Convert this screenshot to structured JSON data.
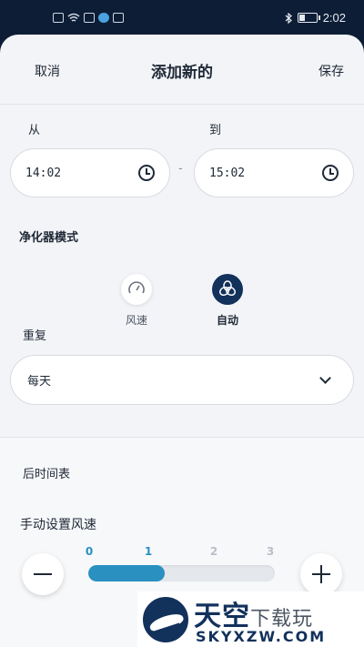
{
  "status_bar": {
    "time": "2:02"
  },
  "header": {
    "cancel_label": "取消",
    "title": "添加新的",
    "save_label": "保存"
  },
  "time_range": {
    "from_label": "从",
    "to_label": "到",
    "from_value": "14:02",
    "to_value": "15:02",
    "separator": "-"
  },
  "purifier_mode": {
    "label": "净化器模式",
    "options": [
      {
        "label": "风速",
        "icon": "gauge-icon",
        "selected": false
      },
      {
        "label": "自动",
        "icon": "swirl-icon",
        "selected": true
      }
    ]
  },
  "repeat": {
    "label": "重复",
    "value": "每天"
  },
  "schedule": {
    "label": "后时间表"
  },
  "fan_speed": {
    "label": "手动设置风速",
    "steps": [
      "0",
      "1",
      "2",
      "3"
    ],
    "current": 1,
    "max": 3,
    "accent": "#2a90c0"
  },
  "watermark": {
    "brand_cn": "天空",
    "brand_cn_small": "下载玩",
    "brand_en": "SKYXZW.COM"
  },
  "colors": {
    "navy": "#12315b",
    "background": "#f3f4f7"
  }
}
